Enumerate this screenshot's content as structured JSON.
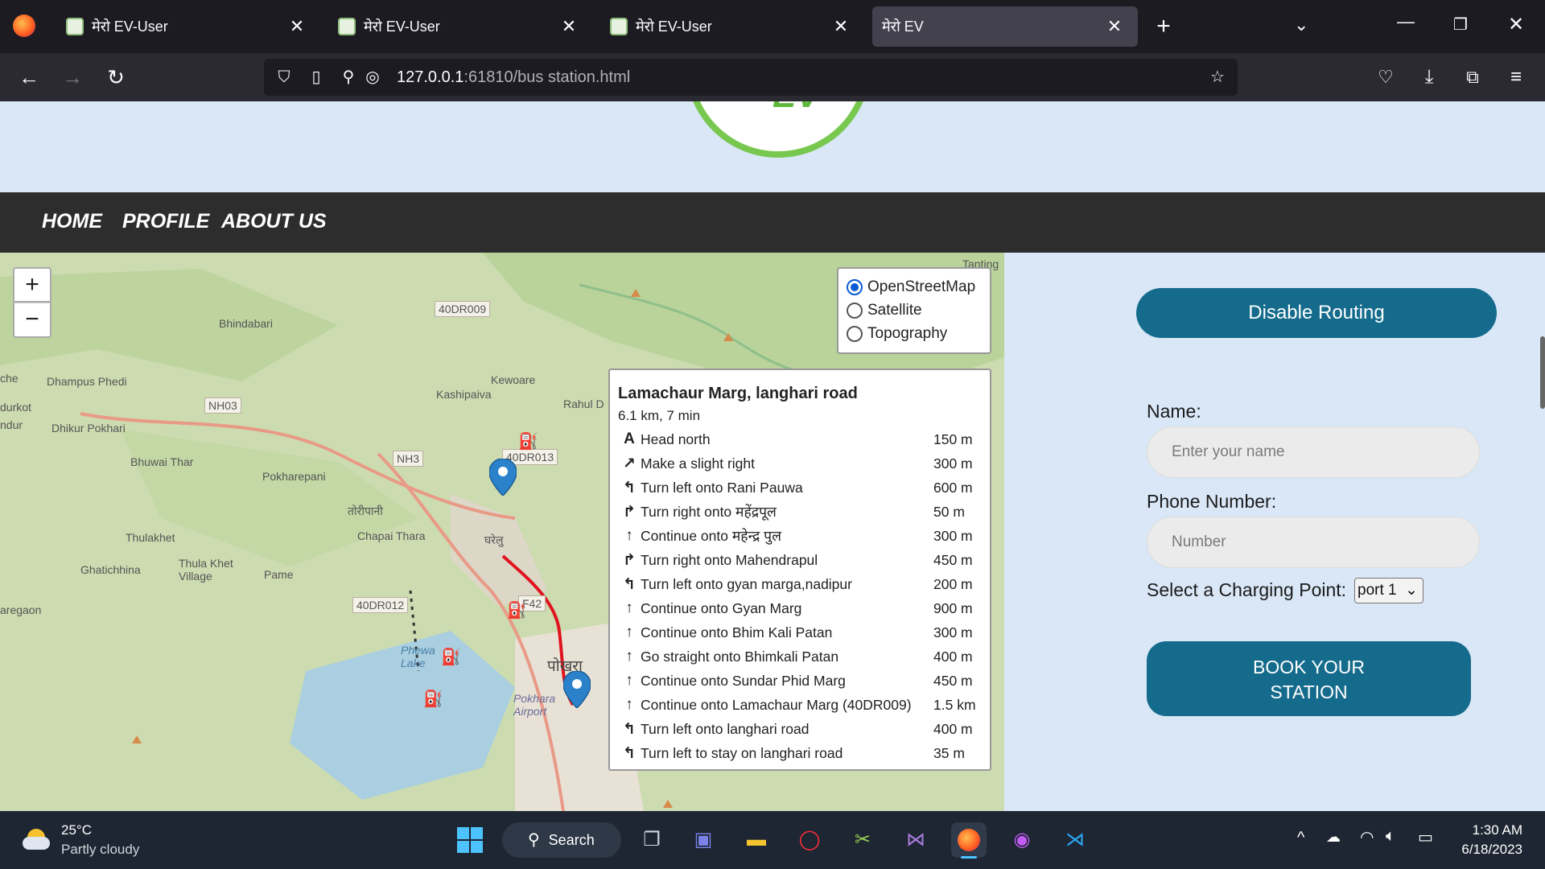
{
  "browser": {
    "tabs": [
      {
        "title": "मेरो EV-User"
      },
      {
        "title": "मेरो EV-User"
      },
      {
        "title": "मेरो EV-User"
      },
      {
        "title": "मेरो EV"
      }
    ],
    "new_tab": "+",
    "url_host": "127.0.0.1",
    "url_path": ":61810/bus station.html"
  },
  "site": {
    "logo_text": "EV",
    "menu": [
      "HOME",
      "PROFILE",
      "ABOUT US"
    ]
  },
  "map": {
    "zoom_in": "+",
    "zoom_out": "−",
    "layers": [
      "OpenStreetMap",
      "Satellite",
      "Topography"
    ],
    "selected_layer": "OpenStreetMap",
    "places": [
      "Tanting",
      "Bhindabari",
      "40DR009",
      "Kewoare",
      "Kashipaiva",
      "Rahul D",
      "Dhampus Phedi",
      "NH03",
      "Dhikur Pokhari",
      "durkot",
      "ndur",
      "NH3",
      "40DR013",
      "Bhuwai Thar",
      "Pokharepani",
      "तोरीपानी",
      "Chapai Thara",
      "घरेलु",
      "Thulakhet",
      "Ghatichhina",
      "Thula Khet Village",
      "Pame",
      "40DR012",
      "F42",
      "aregaon",
      "Phewa Lake",
      "पोखरा",
      "Pokhara Airport",
      "che"
    ],
    "route": {
      "title": "Lamachaur Marg, langhari road",
      "summary": "6.1 km, 7 min",
      "steps": [
        {
          "icon": "A",
          "text": "Head north",
          "dist": "150 m"
        },
        {
          "icon": "↗",
          "text": "Make a slight right",
          "dist": "300 m"
        },
        {
          "icon": "↰",
          "text": "Turn left onto Rani Pauwa",
          "dist": "600 m"
        },
        {
          "icon": "↱",
          "text": "Turn right onto महेंद्रपूल",
          "dist": "50 m"
        },
        {
          "icon": "↑",
          "text": "Continue onto महेन्द्र पुल",
          "dist": "300 m"
        },
        {
          "icon": "↱",
          "text": "Turn right onto Mahendrapul",
          "dist": "450 m"
        },
        {
          "icon": "↰",
          "text": "Turn left onto gyan marga,nadipur",
          "dist": "200 m"
        },
        {
          "icon": "↑",
          "text": "Continue onto Gyan Marg",
          "dist": "900 m"
        },
        {
          "icon": "↑",
          "text": "Continue onto Bhim Kali Patan",
          "dist": "300 m"
        },
        {
          "icon": "↑",
          "text": "Go straight onto Bhimkali Patan",
          "dist": "400 m"
        },
        {
          "icon": "↑",
          "text": "Continue onto Sundar Phid Marg",
          "dist": "450 m"
        },
        {
          "icon": "↑",
          "text": "Continue onto Lamachaur Marg (40DR009)",
          "dist": "1.5 km"
        },
        {
          "icon": "↰",
          "text": "Turn left onto langhari road",
          "dist": "400 m"
        },
        {
          "icon": "↰",
          "text": "Turn left to stay on langhari road",
          "dist": "35 m"
        }
      ]
    }
  },
  "form": {
    "disable_routing": "Disable Routing",
    "name_label": "Name:",
    "name_placeholder": "Enter your name",
    "phone_label": "Phone Number:",
    "phone_placeholder": "Number",
    "charging_label": "Select a Charging Point:",
    "charging_value": "port 1",
    "book_line1": "BOOK YOUR",
    "book_line2": "STATION"
  },
  "taskbar": {
    "weather_temp": "25°C",
    "weather_desc": "Partly cloudy",
    "search": "Search",
    "time": "1:30 AM",
    "date": "6/18/2023"
  },
  "colors": {
    "primary_button": "#156b8c",
    "menu_bar": "#2d2d2d",
    "page_bg": "#d9e7f7",
    "route_line": "#e0141e"
  }
}
